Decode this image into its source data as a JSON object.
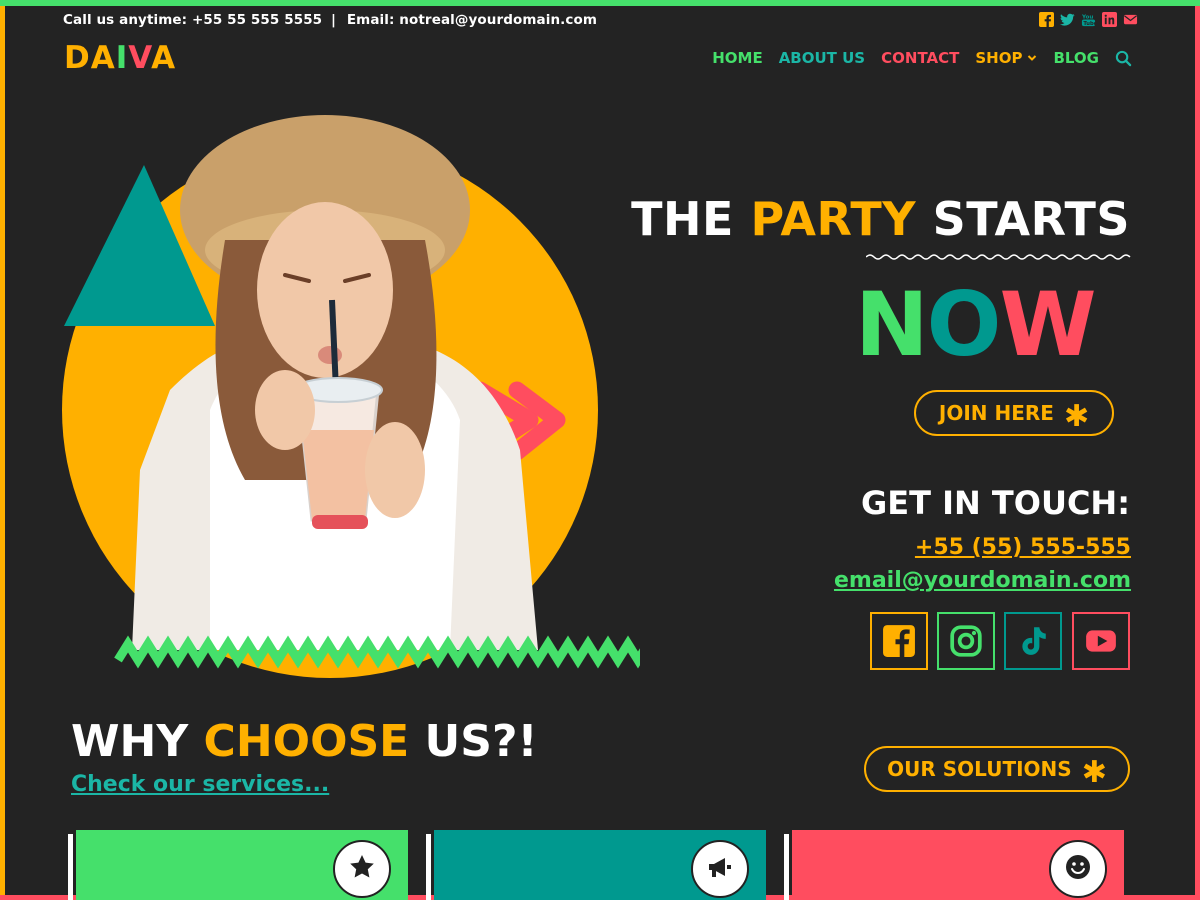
{
  "topbar": {
    "phone_text": "Call us anytime: +55 55 555 5555",
    "separator": "|",
    "email_text": "Email: notreal@yourdomain.com",
    "social_icons": [
      "facebook-icon",
      "twitter-icon",
      "youtube-icon",
      "linkedin-icon",
      "envelope-icon"
    ]
  },
  "logo": {
    "letters": [
      "DA",
      "I",
      "V",
      "A"
    ]
  },
  "nav": {
    "items": [
      {
        "label": "HOME",
        "color": "#45e06b"
      },
      {
        "label": "ABOUT US",
        "color": "#1bb6a6"
      },
      {
        "label": "CONTACT",
        "color": "#ff4d5f"
      },
      {
        "label": "SHOP",
        "color": "#ffb000"
      },
      {
        "label": "BLOG",
        "color": "#45e06b"
      }
    ],
    "search_icon": "search-icon"
  },
  "hero": {
    "headline_1": "THE",
    "headline_2": "PARTY",
    "headline_3": "STARTS",
    "now": [
      "N",
      "O",
      "W"
    ],
    "join_label": "JOIN HERE",
    "join_icon": "✱"
  },
  "contact": {
    "title": "GET IN TOUCH:",
    "phone": "+55 (55) 555-555",
    "email": "email@yourdomain.com",
    "social": [
      {
        "icon": "facebook-icon",
        "color": "#ffb000"
      },
      {
        "icon": "instagram-icon",
        "color": "#45e06b"
      },
      {
        "icon": "tiktok-icon",
        "color": "#00998f"
      },
      {
        "icon": "youtube-icon",
        "color": "#ff4d5f"
      }
    ]
  },
  "why": {
    "title_1": "WHY",
    "title_2": "CHOOSE",
    "title_3": "US?!",
    "link": "Check our services...",
    "button_label": "OUR SOLUTIONS",
    "button_icon": "✱"
  },
  "cards": [
    {
      "color": "#45e06b",
      "icon": "star-icon"
    },
    {
      "color": "#00998f",
      "icon": "megaphone-icon"
    },
    {
      "color": "#ff4d5f",
      "icon": "smile-icon"
    }
  ],
  "colors": {
    "background": "#232323",
    "yellow": "#ffb000",
    "green": "#45e06b",
    "teal": "#00998f",
    "red": "#ff4d5f"
  }
}
